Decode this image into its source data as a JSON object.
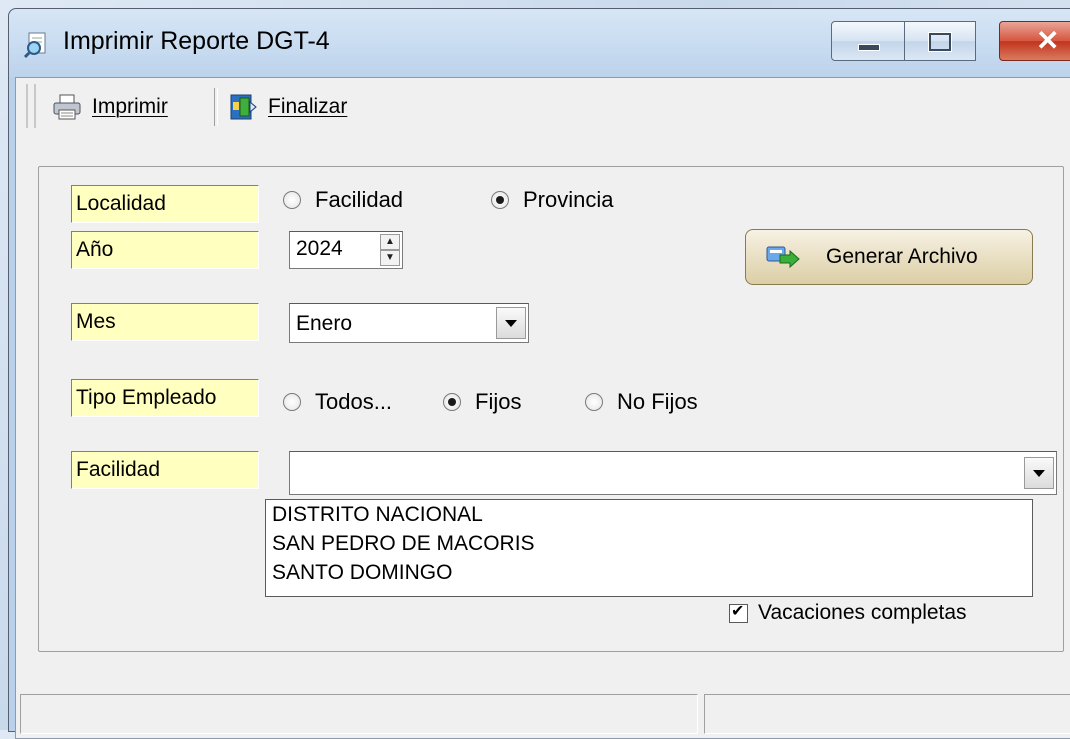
{
  "window": {
    "title": "Imprimir Reporte DGT-4",
    "controls": [
      "minimize",
      "maximize",
      "close"
    ]
  },
  "toolbar": {
    "print_label": "Imprimir",
    "print_accel": "I",
    "finish_label": "Finalizar",
    "finish_accel": "F"
  },
  "form": {
    "localidad": {
      "label": "Localidad",
      "options": [
        {
          "label": "Facilidad",
          "selected": false
        },
        {
          "label": "Provincia",
          "selected": true
        }
      ]
    },
    "anio": {
      "label": "Año",
      "value": "2024"
    },
    "mes": {
      "label": "Mes",
      "value": "Enero"
    },
    "tipo_empleado": {
      "label": "Tipo Empleado",
      "options": [
        {
          "label": "Todos...",
          "selected": false
        },
        {
          "label": "Fijos",
          "selected": true
        },
        {
          "label": "No Fijos",
          "selected": false
        }
      ]
    },
    "facilidad": {
      "label": "Facilidad",
      "value": "",
      "list": [
        "DISTRITO NACIONAL",
        "SAN PEDRO DE MACORIS",
        "SANTO DOMINGO"
      ]
    },
    "generate_button": "Generar Archivo",
    "vacaciones": {
      "label": "Vacaciones completas",
      "checked": true
    }
  },
  "colors": {
    "label_bg": "#ffffc0",
    "window_bg": "#f0f0f0",
    "titlebar": "#bcd3ec",
    "close_button": "#c1341c"
  },
  "icons": [
    "magnifier-document-icon",
    "printer-icon",
    "exit-door-icon",
    "arrow-right-icon"
  ]
}
